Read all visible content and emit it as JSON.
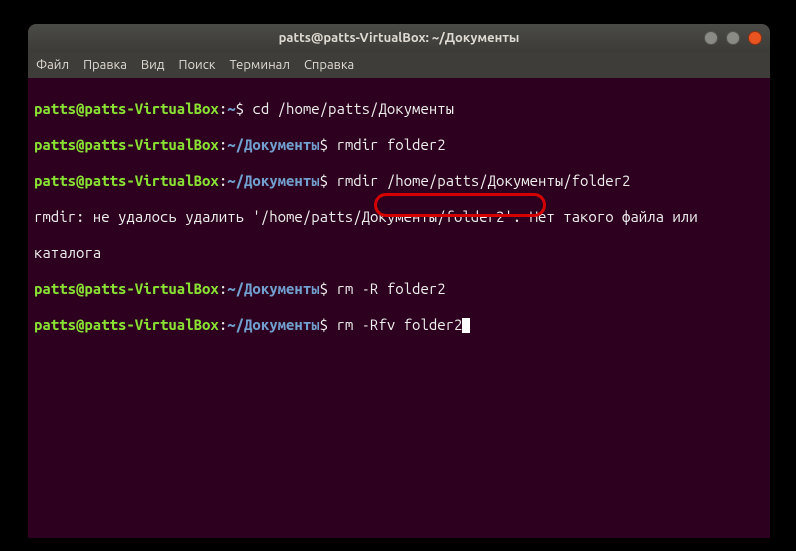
{
  "titlebar": {
    "text": "patts@patts-VirtualBox: ~/Документы"
  },
  "menubar": {
    "file": "Файл",
    "edit": "Правка",
    "view": "Вид",
    "search": "Поиск",
    "terminal": "Терминал",
    "help": "Справка"
  },
  "lines": {
    "l1_user": "patts@patts-VirtualBox",
    "l1_colon": ":",
    "l1_path": "~",
    "l1_dollar": "$ ",
    "l1_cmd": "cd /home/patts/Документы",
    "l2_user": "patts@patts-VirtualBox",
    "l2_colon": ":",
    "l2_path": "~/Документы",
    "l2_dollar": "$ ",
    "l2_cmd": "rmdir folder2",
    "l3_user": "patts@patts-VirtualBox",
    "l3_colon": ":",
    "l3_path": "~/Документы",
    "l3_dollar": "$ ",
    "l3_cmd": "rmdir /home/patts/Документы/folder2",
    "l4_out": "rmdir: не удалось удалить '/home/patts/Документы/folder2': Нет такого файла или",
    "l5_out": "каталога",
    "l6_user": "patts@patts-VirtualBox",
    "l6_colon": ":",
    "l6_path": "~/Документы",
    "l6_dollar": "$ ",
    "l6_cmd": "rm -R folder2",
    "l7_user": "patts@patts-VirtualBox",
    "l7_colon": ":",
    "l7_path": "~/Документы",
    "l7_dollar": "$ ",
    "l7_cmd": "rm -Rfv folder2"
  }
}
